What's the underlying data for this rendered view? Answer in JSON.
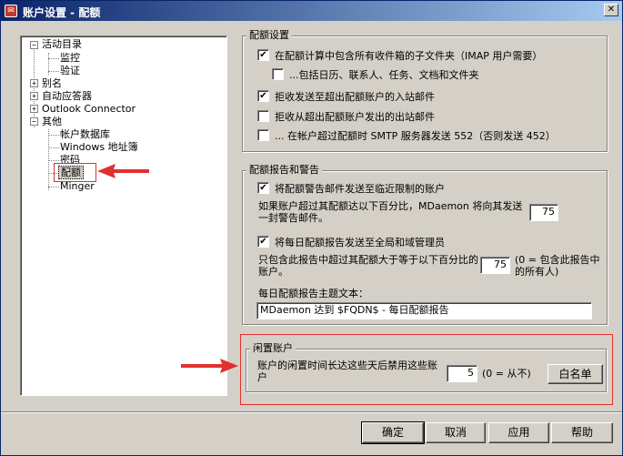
{
  "window": {
    "title": "账户设置 - 配额"
  },
  "tree": {
    "items": [
      {
        "label": "活动目录",
        "expander": "−"
      },
      {
        "label": "监控"
      },
      {
        "label": "验证"
      },
      {
        "label": "别名",
        "expander": "+"
      },
      {
        "label": "自动应答器",
        "expander": "+"
      },
      {
        "label": "Outlook Connector",
        "expander": "+"
      },
      {
        "label": "其他",
        "expander": "−"
      },
      {
        "label": "帐户数据库"
      },
      {
        "label": "Windows 地址簿"
      },
      {
        "label": "密码"
      },
      {
        "label": "配额"
      },
      {
        "label": "Minger"
      }
    ]
  },
  "quota_settings": {
    "title": "配额设置",
    "opt1": {
      "label": "在配额计算中包含所有收件箱的子文件夹（IMAP 用户需要）",
      "checked": "✔"
    },
    "opt2": {
      "label": "...包括日历、联系人、任务、文档和文件夹",
      "checked": ""
    },
    "opt3": {
      "label": "拒收发送至超出配额账户的入站邮件",
      "checked": "✔"
    },
    "opt4": {
      "label": "拒收从超出配额账户发出的出站邮件",
      "checked": ""
    },
    "opt5": {
      "label": "... 在帐户超过配额时 SMTP 服务器发送 552（否则发送 452）",
      "checked": ""
    }
  },
  "quota_reports": {
    "title": "配额报告和警告",
    "warn": {
      "label": "将配额警告邮件发送至临近限制的账户",
      "checked": "✔"
    },
    "warn_desc": "如果账户超过其配额达以下百分比，MDaemon 将向其发送一封警告邮件。",
    "warn_value": "75",
    "daily": {
      "label": "将每日配额报告发送至全局和域管理员",
      "checked": "✔"
    },
    "daily_desc": "只包含此报告中超过其配额大于等于以下百分比的账户。",
    "daily_value": "75",
    "daily_hint": "(0 = 包含此报告中的所有人)",
    "subject_label": "每日配额报告主题文本：",
    "subject_value": "MDaemon 达到 $FQDN$ - 每日配额报告"
  },
  "idle": {
    "title": "闲置账户",
    "desc": "账户的闲置时间长达这些天后禁用这些账户",
    "value": "5",
    "hint": "(0 = 从不)",
    "whitelist_label": "白名单"
  },
  "buttons": {
    "ok": "确定",
    "cancel": "取消",
    "apply": "应用",
    "help": "帮助"
  },
  "colors": {
    "annotation": "#e03030",
    "title_bar": "#0a246a"
  }
}
